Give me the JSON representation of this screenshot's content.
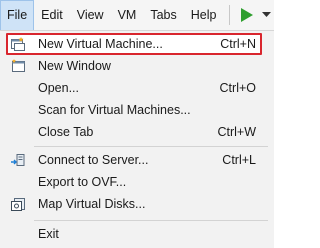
{
  "menubar": {
    "items": [
      "File",
      "Edit",
      "View",
      "VM",
      "Tabs",
      "Help"
    ],
    "play_color": "#2e9e2e"
  },
  "file_menu": {
    "items": [
      {
        "label": "New Virtual Machine...",
        "shortcut": "Ctrl+N",
        "icon": "new-vm-icon"
      },
      {
        "label": "New Window",
        "shortcut": "",
        "icon": "new-window-icon"
      },
      {
        "label": "Open...",
        "shortcut": "Ctrl+O",
        "icon": ""
      },
      {
        "label": "Scan for Virtual Machines...",
        "shortcut": "",
        "icon": ""
      },
      {
        "label": "Close Tab",
        "shortcut": "Ctrl+W",
        "icon": ""
      },
      {
        "label": "Connect to Server...",
        "shortcut": "Ctrl+L",
        "icon": "connect-server-icon"
      },
      {
        "label": "Export to OVF...",
        "shortcut": "",
        "icon": ""
      },
      {
        "label": "Map Virtual Disks...",
        "shortcut": "",
        "icon": "map-disks-icon"
      },
      {
        "label": "Exit",
        "shortcut": "",
        "icon": ""
      }
    ],
    "highlight_color": "#d9262e"
  }
}
